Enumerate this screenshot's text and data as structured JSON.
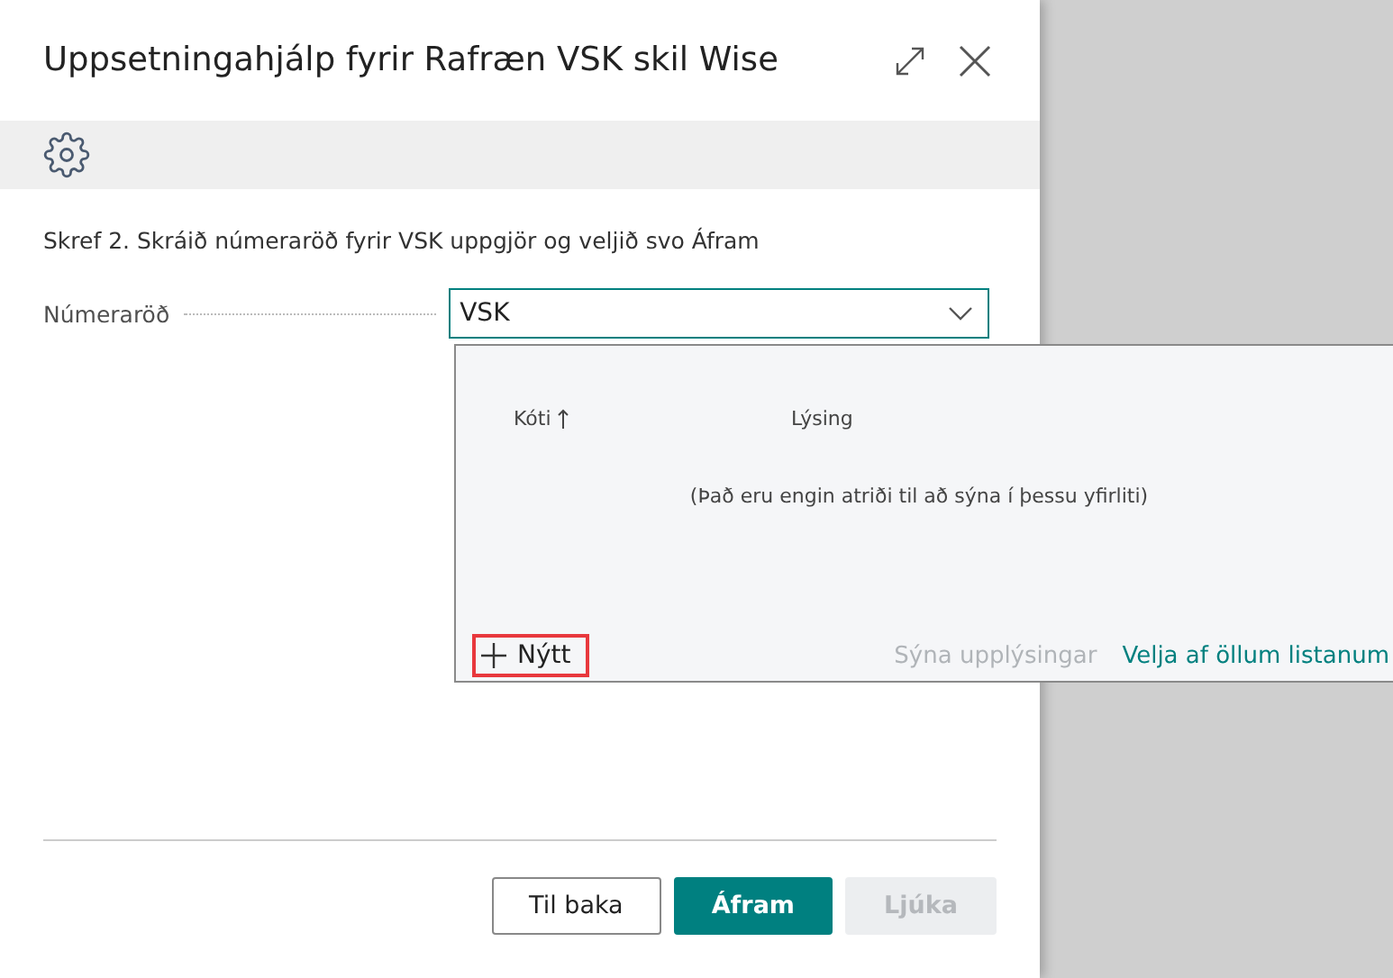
{
  "dialog": {
    "title": "Uppsetningahjálp fyrir Rafræn VSK skil Wise"
  },
  "instruction": "Skref 2. Skráið númeraröð fyrir VSK uppgjör og veljið svo Áfram",
  "field": {
    "label": "Númeraröð",
    "value": "VSK",
    "expanded": true
  },
  "lookup": {
    "columns": [
      {
        "label": "Kóti",
        "sorted": true
      },
      {
        "label": "Lýsing",
        "sorted": false
      }
    ],
    "empty_message": "(Það eru engin atriði til að sýna í þessu yfirliti)",
    "new_action": {
      "label": "Nýtt",
      "highlighted": true
    },
    "links": [
      {
        "label": "Sýna upplýsingar",
        "disabled": true
      },
      {
        "label": "Velja af öllum listanum",
        "disabled": false
      }
    ]
  },
  "buttons": [
    {
      "label": "Til baka",
      "kind": "secondary"
    },
    {
      "label": "Áfram",
      "kind": "primary"
    },
    {
      "label": "Ljúka",
      "kind": "disabled"
    }
  ]
}
